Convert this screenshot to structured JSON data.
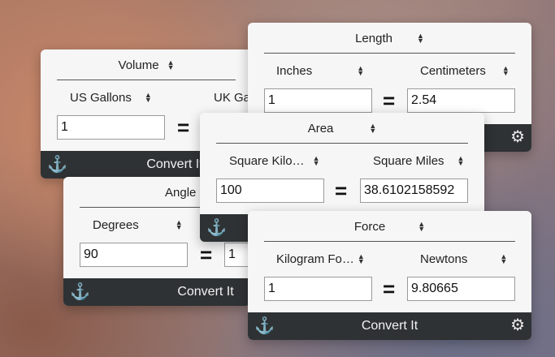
{
  "volume": {
    "category": "Volume",
    "from_unit": "US Gallons",
    "to_unit": "UK Ga",
    "from_value": "1",
    "footer_label": "Convert It",
    "equals": "="
  },
  "angle": {
    "category": "Angle",
    "from_unit": "Degrees",
    "from_value": "90",
    "to_value": "1",
    "footer_label": "Convert It",
    "equals": "="
  },
  "length": {
    "category": "Length",
    "from_unit": "Inches",
    "to_unit": "Centimeters",
    "from_value": "1",
    "to_value": "2.54",
    "equals": "="
  },
  "area": {
    "category": "Area",
    "from_unit": "Square Kilo…",
    "to_unit": "Square Miles",
    "from_value": "100",
    "to_value": "38.6102158592",
    "equals": "="
  },
  "force": {
    "category": "Force",
    "from_unit": "Kilogram Fo…",
    "to_unit": "Newtons",
    "from_value": "1",
    "to_value": "9.80665",
    "footer_label": "Convert It",
    "equals": "="
  },
  "icons": {
    "anchor": "anchor-icon",
    "gear": "gear-icon",
    "updown": "updown-chevron-icon"
  }
}
